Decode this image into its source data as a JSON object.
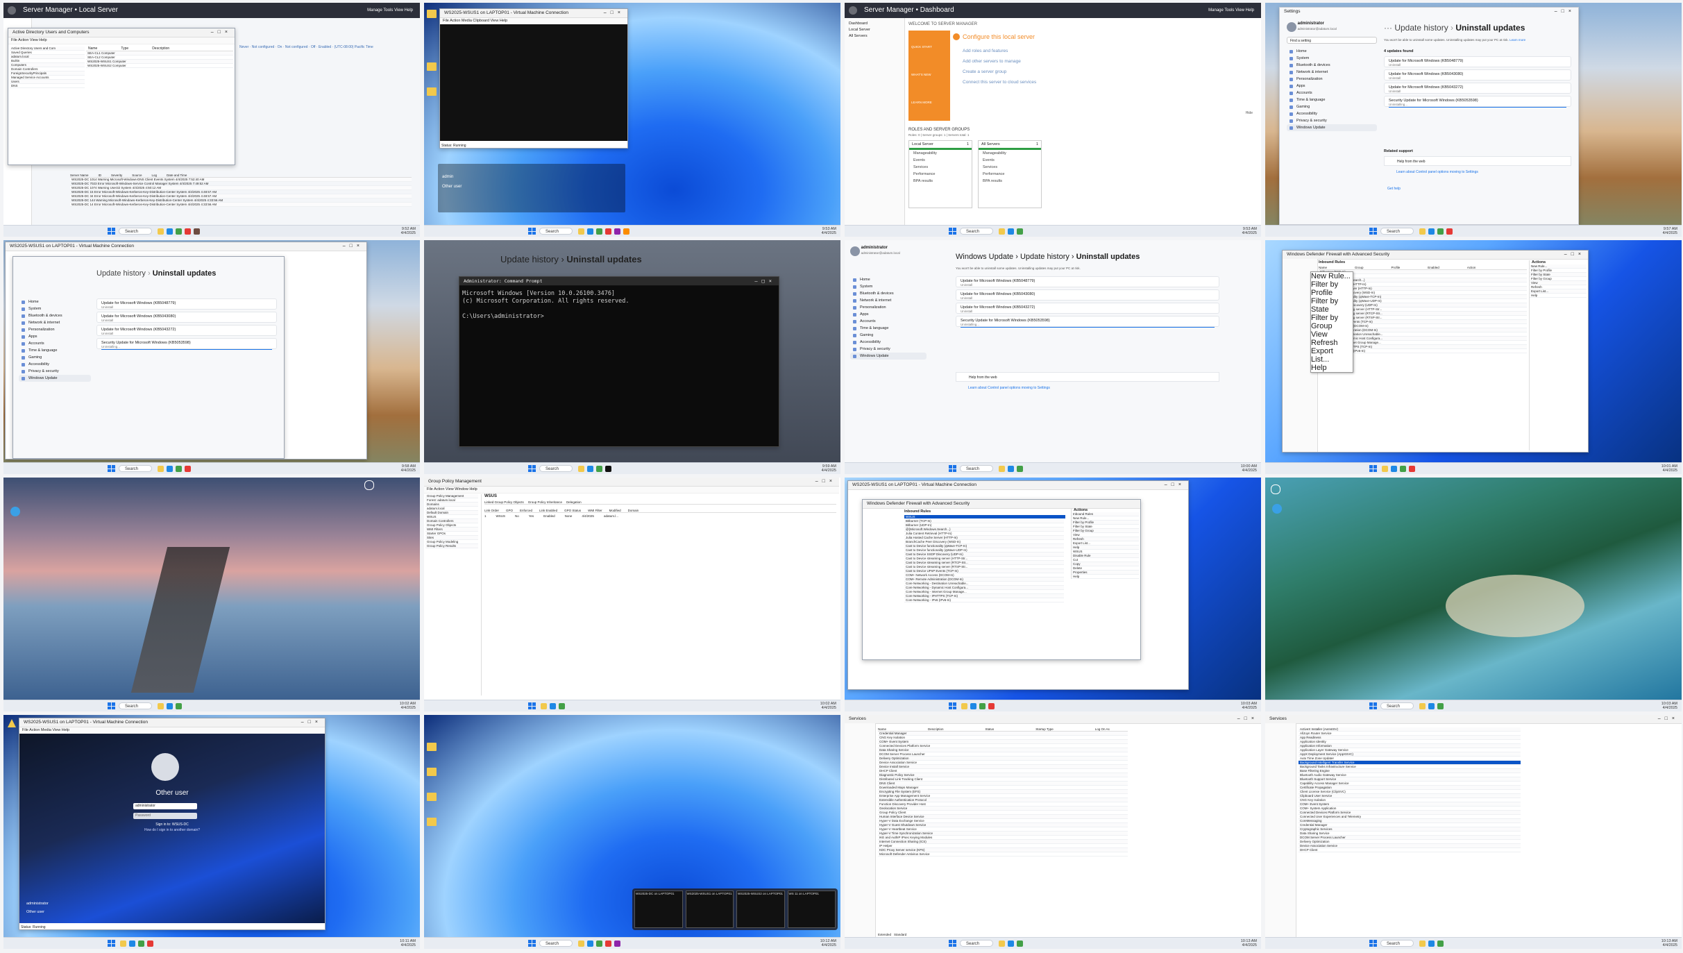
{
  "tiles": {
    "t1": {
      "title": "Server Manager • Local Server",
      "menus": "Manage  Tools  View  Help",
      "dialog_title": "Active Directory Users and Computers",
      "dialog_menu": "File  Action  View  Help",
      "tree": [
        "Active Directory Users and Com",
        "Saved Queries",
        "adatum.local",
        "Builtin",
        "Computers",
        "Domain Controllers",
        "ForeignSecurityPrincipals",
        "Managed Service Accounts",
        "Users",
        "DNS"
      ],
      "list_headers": [
        "Name",
        "Type",
        "Description"
      ],
      "list_rows": [
        "SEA-CL1 Computer",
        "SEA-CL2 Computer",
        "WS2025-WSUS1 Computer",
        "WS2025-WSUS2 Computer"
      ],
      "events_headers": [
        "Server Name",
        "ID",
        "Severity",
        "Source",
        "Log",
        "Date and Time"
      ],
      "events": [
        "WS2025-DC  1014  Warning  Microsoft-Windows-DNS Client Events  System  4/4/2025 7:52:40 AM",
        "WS2025-DC  7023  Error  Microsoft-Windows-Service Control Manager  System  4/4/2025 7:49:52 AM",
        "WS2025-DC  1074  Warning  User32  System  4/4/2025 4:50:12 AM",
        "WS2025-DC  15  Error  Microsoft-Windows-Kerberos-Key-Distribution-Center  System  4/4/2025 4:48:57 AM",
        "WS2025-DC  34  Error  Microsoft-Windows-Kerberos-Key-Distribution-Center  System  4/4/2025 4:48:57 AM",
        "WS2025-DC  144  Warning  Microsoft-Windows-Kerberos-Key-Distribution-Center  System  4/4/2025 4:33:56 AM",
        "WS2025-DC  14  Error  Microsoft-Windows-Kerberos-Key-Distribution-Center  System  4/4/2025 4:33:56 AM"
      ],
      "search": "Search",
      "time": "9:52 AM",
      "date": "4/4/2025"
    },
    "t2": {
      "title": "WS2025-WSUS1 on LAPTOP01 - Virtual Machine Connection",
      "menu": "File  Action  Media  Clipboard  View  Help",
      "status": "Status: Running",
      "users": [
        "admin",
        "Other user"
      ],
      "search": "Search",
      "time": "9:53 AM",
      "date": "4/4/2025"
    },
    "t3": {
      "title": "Server Manager • Dashboard",
      "menus": "Manage  Tools  View  Help",
      "nav": [
        "Dashboard",
        "Local Server",
        "All Servers"
      ],
      "welcome": "WELCOME TO SERVER MANAGER",
      "configure": "Configure this local server",
      "steps": [
        "Add roles and features",
        "Add other servers to manage",
        "Create a server group",
        "Connect this server to cloud services"
      ],
      "side_labels": [
        "QUICK START",
        "WHAT'S NEW",
        "LEARN MORE"
      ],
      "hide": "Hide",
      "groups_title": "ROLES AND SERVER GROUPS",
      "groups_sub": "Roles: 0  |  Server groups: 1  |  Servers total: 1",
      "cards": [
        {
          "name": "Local Server",
          "count": "1",
          "items": [
            "Manageability",
            "Events",
            "Services",
            "Performance",
            "BPA results"
          ]
        },
        {
          "name": "All Servers",
          "count": "1",
          "items": [
            "Manageability",
            "Events",
            "Services",
            "Performance",
            "BPA results"
          ]
        }
      ],
      "search": "Search",
      "time": "9:53 AM",
      "date": "4/4/2025"
    },
    "t4": {
      "window": "Settings",
      "user": "administrator",
      "email": "administrator@adatum.local",
      "breadcrumb": [
        "Update history",
        "Uninstall updates"
      ],
      "note": "You won't be able to uninstall some updates. Uninstalling updates may put your PC at risk.",
      "learn": "Learn more",
      "find": "Find a setting",
      "nav": [
        "Home",
        "System",
        "Bluetooth & devices",
        "Network & internet",
        "Personalization",
        "Apps",
        "Accounts",
        "Time & language",
        "Gaming",
        "Accessibility",
        "Privacy & security",
        "Windows Update"
      ],
      "found": "4 updates found",
      "updates": [
        {
          "name": "Update for Microsoft Windows (KB5048779)",
          "state": "Uninstall"
        },
        {
          "name": "Update for Microsoft Windows (KB5043080)",
          "state": "Uninstall"
        },
        {
          "name": "Update for Microsoft Windows (KB5043272)",
          "state": "Uninstall"
        },
        {
          "name": "Security Update for Microsoft Windows (KB5053598)",
          "state": "Uninstalling..."
        }
      ],
      "related": "Related support",
      "help_web": "Help from the web",
      "control_panel": "Learn about Control panel options moving to Settings",
      "get_help": "Get help",
      "search": "Search",
      "time": "9:57 AM",
      "date": "4/4/2025"
    },
    "t5": {
      "title": "WS2025-WSUS1 on LAPTOP01 - Virtual Machine Connection",
      "search": "Search",
      "time": "9:58 AM",
      "date": "4/4/2025"
    },
    "t6": {
      "cmd_title": "Administrator: Command Prompt",
      "cmd_lines": [
        "Microsoft Windows [Version 10.0.26100.3476]",
        "(c) Microsoft Corporation. All rights reserved.",
        "",
        "C:\\Users\\administrator>"
      ],
      "settings_breadcrumb": [
        "Update history",
        "Uninstall updates"
      ],
      "search": "Search",
      "time": "9:59 AM",
      "date": "4/4/2025"
    },
    "t7": {
      "breadcrumb": [
        "Windows Update",
        "Update history",
        "Uninstall updates"
      ],
      "search": "Search",
      "time": "10:00 AM",
      "date": "4/4/2025"
    },
    "t8": {
      "title": "Windows Defender Firewall with Advanced Security",
      "section": "Inbound Rules",
      "actions": "Actions",
      "cols": [
        "Name",
        "Group",
        "Profile",
        "Enabled",
        "Action"
      ],
      "rules": [
        "Bitburner (TCP-In)",
        "Bitburner (UDP-In)",
        "@{Microsoft.Windows.Search...}",
        "Julia Content Retrieval (HTTP-In)",
        "Julia Hosted Cache Server (HTTP-In)",
        "BranchCache Peer Discovery (WSD-In)",
        "Cast to Device functionality (qWave-TCP-In)",
        "Cast to Device functionality (qWave-UDP-In)",
        "Cast to Device SSDP Discovery (UDP-In)",
        "Cast to Device streaming server (HTTP-Str...",
        "Cast to Device streaming server (RTCP-Str...",
        "Cast to Device streaming server (RTSP-Str...",
        "Cast to Device UPnP Events (TCP-In)",
        "COM+ Network Access (DCOM-In)",
        "COM+ Remote Administration (DCOM-In)",
        "Core Networking - Destination Unreachable...",
        "Core Networking - Dynamic Host Configura...",
        "Core Networking - Internet Group Manage...",
        "Core Networking - IPHTTPS (TCP-In)",
        "Core Networking - IPv6 (IPv6-In)"
      ],
      "action_items": [
        "New Rule...",
        "Filter by Profile",
        "Filter by State",
        "Filter by Group",
        "View",
        "Refresh",
        "Export List...",
        "Help"
      ],
      "time": "10:01 AM",
      "date": "4/4/2025"
    },
    "t9": {
      "time": "10:02 AM",
      "date": "4/4/2025",
      "search": "Search"
    },
    "t10": {
      "title": "Group Policy Management",
      "menu": "File  Action  View  Window  Help",
      "tree": [
        "Group Policy Management",
        "Forest: adatum.local",
        "Domains",
        "adatum.local",
        "Default Domain",
        "WSUS",
        "Domain Controllers",
        "Group Policy Objects",
        "WMI Filters",
        "Starter GPOs",
        "Sites",
        "Group Policy Modeling",
        "Group Policy Results"
      ],
      "pane_title": "WSUS",
      "tabs": [
        "Linked Group Policy Objects",
        "Group Policy Inheritance",
        "Delegation"
      ],
      "cols": [
        "Link Order",
        "GPO",
        "Enforced",
        "Link Enabled",
        "GPO Status",
        "WMI Filter",
        "Modified",
        "Domain"
      ],
      "row": [
        "1",
        "WSUS",
        "No",
        "Yes",
        "Enabled",
        "None",
        "4/4/2025",
        "adatum.l..."
      ],
      "time": "10:02 AM",
      "date": "4/4/2025"
    },
    "t11": {
      "title": "WS2025-WSUS1 on LAPTOP01 - Virtual Machine Connection",
      "fw_title": "Windows Defender Firewall with Advanced Security",
      "section": "Inbound Rules",
      "selected": "WSUS",
      "actions": "Actions",
      "action_items": [
        "Inbound Rules",
        "New Rule...",
        "Filter by Profile",
        "Filter by State",
        "Filter by Group",
        "View",
        "Refresh",
        "Export List...",
        "Help",
        "WSUS",
        "Disable Rule",
        "Cut",
        "Copy",
        "Delete",
        "Properties",
        "Help"
      ],
      "time": "10:03 AM",
      "date": "4/4/2025"
    },
    "t12": {
      "search": "Search",
      "time": "10:03 AM",
      "date": "4/4/2025"
    },
    "t13": {
      "title": "WS2025-WSUS1 on LAPTOP01 - Virtual Machine Connection",
      "menu": "File  Action  Media  View  Help",
      "user": "Other user",
      "username": "administrator",
      "password": "Password",
      "signin_to": "Sign in to: WSUS-DC",
      "how": "How do I sign in to another domain?",
      "users": [
        "administrator",
        "Other user"
      ],
      "status": "Status: Running",
      "time": "10:11 AM",
      "date": "4/4/2025"
    },
    "t14": {
      "thumbs": [
        "WS2025-DC on LAPTOP01",
        "WS2025-WSUS1 on LAPTOP01",
        "WS2025-WSUS2 on LAPTOP01",
        "WS 11 on LAPTOP01"
      ],
      "search": "Search",
      "time": "10:12 AM",
      "date": "4/4/2025"
    },
    "t15": {
      "title": "Services",
      "cols": [
        "Name",
        "Description",
        "Status",
        "Startup Type",
        "Log On As"
      ],
      "rows": [
        "Credential Manager",
        "CNG Key Isolation",
        "COM+ Event System",
        "Connected Devices Platform Service",
        "Data Sharing Service",
        "DCOM Server Process Launcher",
        "Delivery Optimization",
        "Device Association Service",
        "Device Install Service",
        "DHCP Client",
        "Diagnostic Policy Service",
        "Distributed Link Tracking Client",
        "DNS Client",
        "Downloaded Maps Manager",
        "Encrypting File System (EFS)",
        "Enterprise App Management Service",
        "Extensible Authentication Protocol",
        "Function Discovery Provider Host",
        "Geolocation Service",
        "Group Policy Client",
        "Human Interface Device Service",
        "Hyper-V Data Exchange Service",
        "Hyper-V Guest Shutdown Service",
        "Hyper-V Heartbeat Service",
        "Hyper-V Time Synchronization Service",
        "IKE and AuthIP IPsec Keying Modules",
        "Internet Connection Sharing (ICS)",
        "IP Helper",
        "KDC Proxy Server service (KPS)",
        "Microsoft Defender Antivirus Service"
      ],
      "tabs": [
        "Extended",
        "Standard"
      ],
      "search": "Search",
      "time": "10:13 AM",
      "date": "4/4/2025"
    },
    "t16": {
      "title": "Services",
      "selected": "Background Intelligent Transfer Service",
      "rows": [
        "ActiveX Installer (AxInstSV)",
        "AllJoyn Router Service",
        "App Readiness",
        "Application Identity",
        "Application Information",
        "Application Layer Gateway Service",
        "AppX Deployment Service (AppXSVC)",
        "Auto Time Zone Updater",
        "Background Intelligent Transfer Service",
        "Background Tasks Infrastructure Service",
        "Base Filtering Engine",
        "Bluetooth Audio Gateway Service",
        "Bluetooth Support Service",
        "Capability Access Manager Service",
        "Certificate Propagation",
        "Client License Service (ClipSVC)",
        "Clipboard User Service",
        "CNG Key Isolation",
        "COM+ Event System",
        "COM+ System Application",
        "Connected Devices Platform Service",
        "Connected User Experiences and Telemetry",
        "CoreMessaging",
        "Credential Manager",
        "Cryptographic Services",
        "Data Sharing Service",
        "DCOM Server Process Launcher",
        "Delivery Optimization",
        "Device Association Service",
        "DHCP Client"
      ],
      "search": "Search",
      "time": "10:13 AM",
      "date": "4/4/2025"
    }
  },
  "colors": {
    "server_manager_header": "#2c2f3a",
    "accent_orange": "#f28c28",
    "windows_blue": "#1a73e8",
    "selection_blue": "#0a54c7"
  }
}
